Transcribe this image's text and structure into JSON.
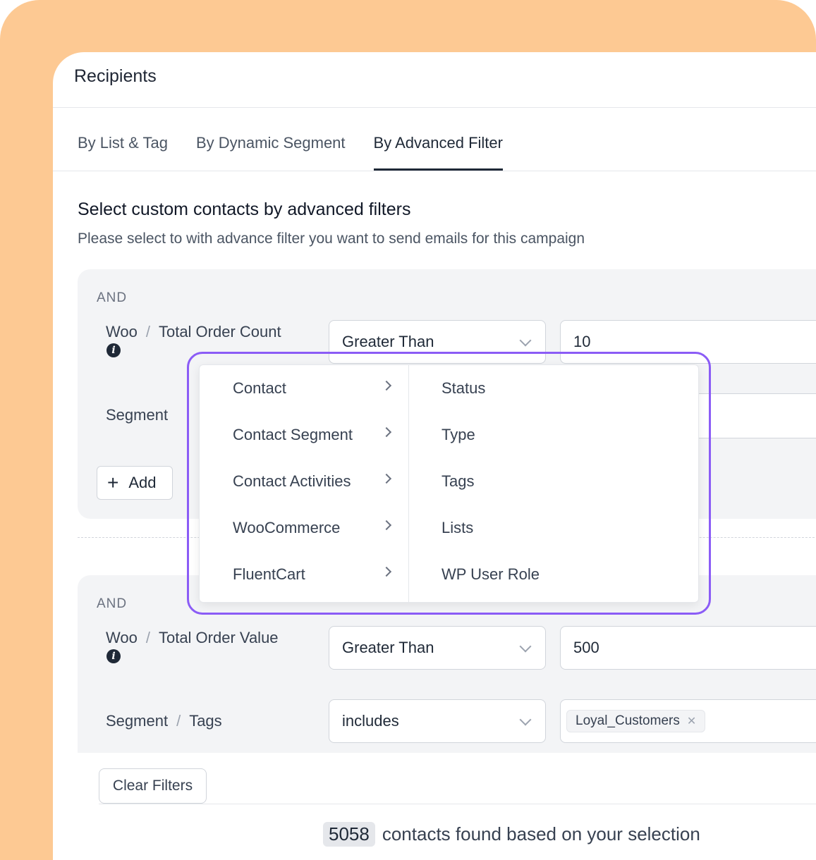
{
  "header": {
    "title": "Recipients"
  },
  "tabs": [
    {
      "label": "By List & Tag"
    },
    {
      "label": "By Dynamic Segment"
    },
    {
      "label": "By Advanced Filter"
    }
  ],
  "section": {
    "title": "Select custom contacts by advanced filters",
    "subtitle": "Please select to with advance filter you want to send emails for this campaign"
  },
  "groups": [
    {
      "and_label": "AND",
      "rule1": {
        "source": "Woo",
        "field": "Total Order Count",
        "operator": "Greater Than",
        "value": "10"
      },
      "rule2": {
        "source": "Segment"
      },
      "add_label": "Add"
    },
    {
      "and_label": "AND",
      "rule1": {
        "source": "Woo",
        "field": "Total Order Value",
        "operator": "Greater Than",
        "value": "500"
      },
      "rule2": {
        "source": "Segment",
        "field": "Tags",
        "operator": "includes",
        "tag": "Loyal_Customers"
      }
    }
  ],
  "dropdown": {
    "categories": [
      {
        "label": "Contact"
      },
      {
        "label": "Contact Segment"
      },
      {
        "label": "Contact Activities"
      },
      {
        "label": "WooCommerce"
      },
      {
        "label": "FluentCart"
      }
    ],
    "options": [
      {
        "label": "Status"
      },
      {
        "label": "Type"
      },
      {
        "label": "Tags"
      },
      {
        "label": "Lists"
      },
      {
        "label": "WP User Role"
      }
    ]
  },
  "actions": {
    "clear_label": "Clear Filters"
  },
  "summary": {
    "count": "5058",
    "text": "contacts found based on your selection"
  },
  "colors": {
    "backdrop": "#fdc993",
    "highlight": "#8b5cf6"
  }
}
